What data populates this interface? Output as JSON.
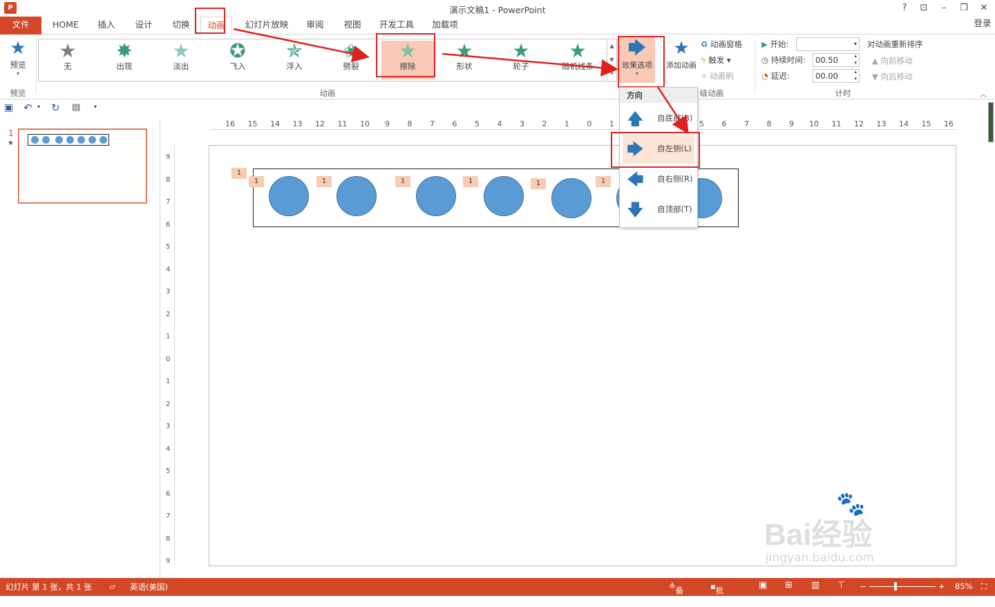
{
  "titlebar": {
    "app_icon": "P",
    "title": "演示文稿1 - PowerPoint",
    "help": "?",
    "ribbon_opts": "⊡",
    "minimize": "–",
    "restore": "❐",
    "close": "✕"
  },
  "tabs": [
    {
      "label": "文件"
    },
    {
      "label": "HOME"
    },
    {
      "label": "插入"
    },
    {
      "label": "设计"
    },
    {
      "label": "切换"
    },
    {
      "label": "动画"
    },
    {
      "label": "幻灯片放映"
    },
    {
      "label": "审阅"
    },
    {
      "label": "视图"
    },
    {
      "label": "开发工具"
    },
    {
      "label": "加载项"
    }
  ],
  "login": "登录",
  "ribbon": {
    "preview_label": "预览",
    "preview_group": "预览",
    "animations_group": "动画",
    "animations": [
      {
        "label": "无",
        "color": "#7f7f7f"
      },
      {
        "label": "出现",
        "color": "#3a9a7a"
      },
      {
        "label": "淡出",
        "color": "#8ccbb0"
      },
      {
        "label": "飞入",
        "color": "#3a9a7a"
      },
      {
        "label": "浮入",
        "color": "#3a9a7a"
      },
      {
        "label": "劈裂",
        "color": "#3a9a7a"
      },
      {
        "label": "擦除",
        "color": "#7bc2a6"
      },
      {
        "label": "形状",
        "color": "#3a9a7a"
      },
      {
        "label": "轮子",
        "color": "#3a9a7a"
      },
      {
        "label": "随机线条",
        "color": "#3a9a7a"
      }
    ],
    "effect_options": "效果选项",
    "add_animation": "添加动画",
    "anim_pane": "动画窗格",
    "trigger": "触发",
    "anim_painter": "动画刷",
    "advanced_group_partial": "级动画",
    "start_label": "开始:",
    "start_value": "",
    "duration_label": "持续时间:",
    "duration_value": "00.50",
    "delay_label": "延迟:",
    "delay_value": "00.00",
    "reorder_title": "对动画重新排序",
    "move_earlier": "向前移动",
    "move_later": "向后移动",
    "timing_group": "计时"
  },
  "dropdown": {
    "header": "方向",
    "items": [
      {
        "label": "自底部(B)",
        "icon": "arrow-up-icon",
        "glyph": "🡅"
      },
      {
        "label": "自左侧(L)",
        "icon": "arrow-right-icon",
        "glyph": "🡆"
      },
      {
        "label": "自右侧(R)",
        "icon": "arrow-left-icon",
        "glyph": "🡄"
      },
      {
        "label": "自顶部(T)",
        "icon": "arrow-down-icon",
        "glyph": "🡇"
      }
    ]
  },
  "hruler_labels": [
    "16",
    "15",
    "14",
    "13",
    "12",
    "11",
    "10",
    "9",
    "8",
    "7",
    "6",
    "5",
    "4",
    "3",
    "2",
    "1",
    "0",
    "1",
    "2",
    "3",
    "4",
    "5",
    "6",
    "7",
    "8",
    "9",
    "10",
    "11",
    "12",
    "13",
    "14",
    "15",
    "16"
  ],
  "vruler_labels": [
    "9",
    "8",
    "7",
    "6",
    "5",
    "4",
    "3",
    "2",
    "1",
    "0",
    "1",
    "2",
    "3",
    "4",
    "5",
    "6",
    "7",
    "8",
    "9"
  ],
  "slide_pane": {
    "number": "1",
    "star": "★"
  },
  "slide": {
    "anim_tags": [
      "1",
      "1",
      "1",
      "1",
      "1",
      "1",
      "1"
    ],
    "circle_color": "#5b9bd5"
  },
  "status": {
    "slide_info": "幻灯片 第 1 张，共 1 张",
    "language": "英语(美国)",
    "notes": "备注",
    "comments": "批注",
    "zoom": "85%"
  },
  "watermark": {
    "text": "Bai经验",
    "url": "jingyan.baidu.com"
  },
  "colors": {
    "accent": "#d24726",
    "highlight": "#f7c9b6",
    "annotation_red": "#e02020"
  }
}
